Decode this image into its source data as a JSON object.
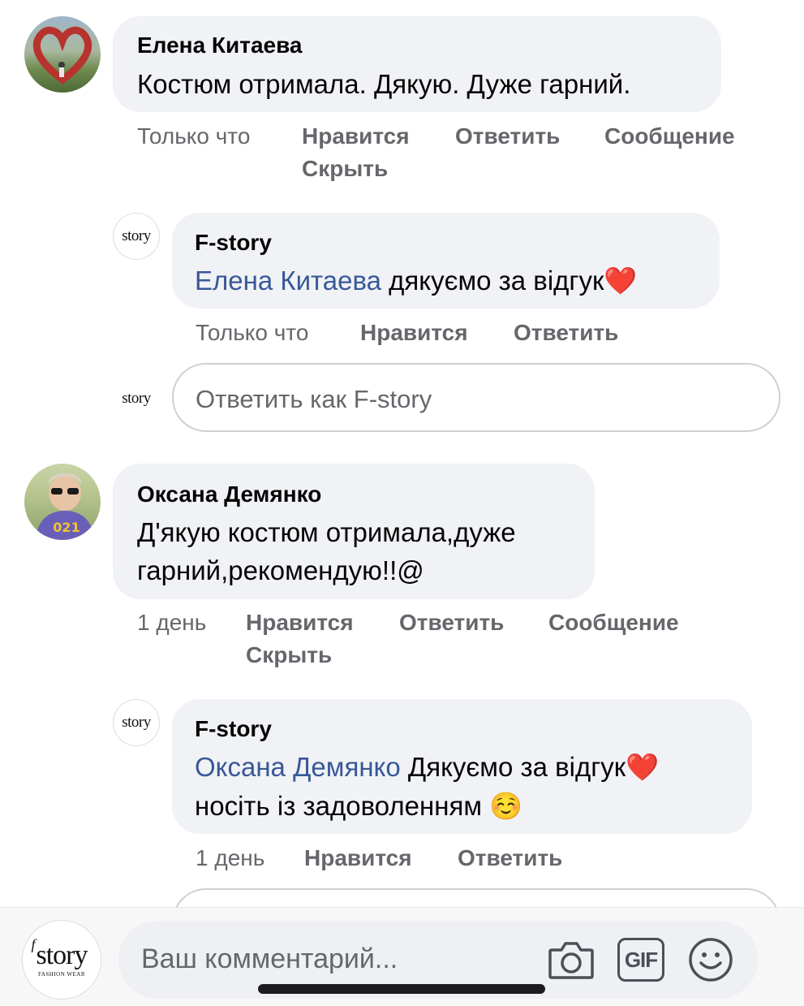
{
  "comments": [
    {
      "author": "Елена Китаева",
      "text": "Костюм отримала. Дякую. Дуже гарний.",
      "time": "Только что",
      "actions": [
        "Нравится",
        "Ответить",
        "Сообщение",
        "Скрыть"
      ],
      "reply": {
        "author": "F-story",
        "mention": "Елена Китаева",
        "text": " дякуємо за відгук",
        "emoji": "❤️",
        "time": "Только что",
        "actions": [
          "Нравится",
          "Ответить"
        ]
      }
    },
    {
      "author": "Оксана Демянко",
      "text_line1": "Д'якую костюм отримала,дуже",
      "text_line2": "гарний,рекомендую!!@",
      "time": "1 день",
      "actions": [
        "Нравится",
        "Ответить",
        "Сообщение",
        "Скрыть"
      ],
      "reply": {
        "author": "F-story",
        "mention": "Оксана Демянко",
        "text": " Дякуємо за відгук",
        "emoji": "❤️",
        "text_line2": "носіть із задоволенням ",
        "emoji2": "☺️",
        "time": "1 день",
        "actions": [
          "Нравится",
          "Ответить"
        ]
      }
    }
  ],
  "reply_box": {
    "placeholder": "Ответить как F-story"
  },
  "composer": {
    "placeholder": "Ваш комментарий...",
    "gif_label": "GIF"
  },
  "brand": {
    "logo_text": "story",
    "logo_letter": "f",
    "logo_subtext": "FASHION WEAR"
  },
  "colors": {
    "bubble": "#f0f2f5",
    "mention": "#385898",
    "meta": "#65676b",
    "heart": "#e0245e"
  },
  "icons": [
    "camera-icon",
    "gif-icon",
    "smiley-icon"
  ]
}
